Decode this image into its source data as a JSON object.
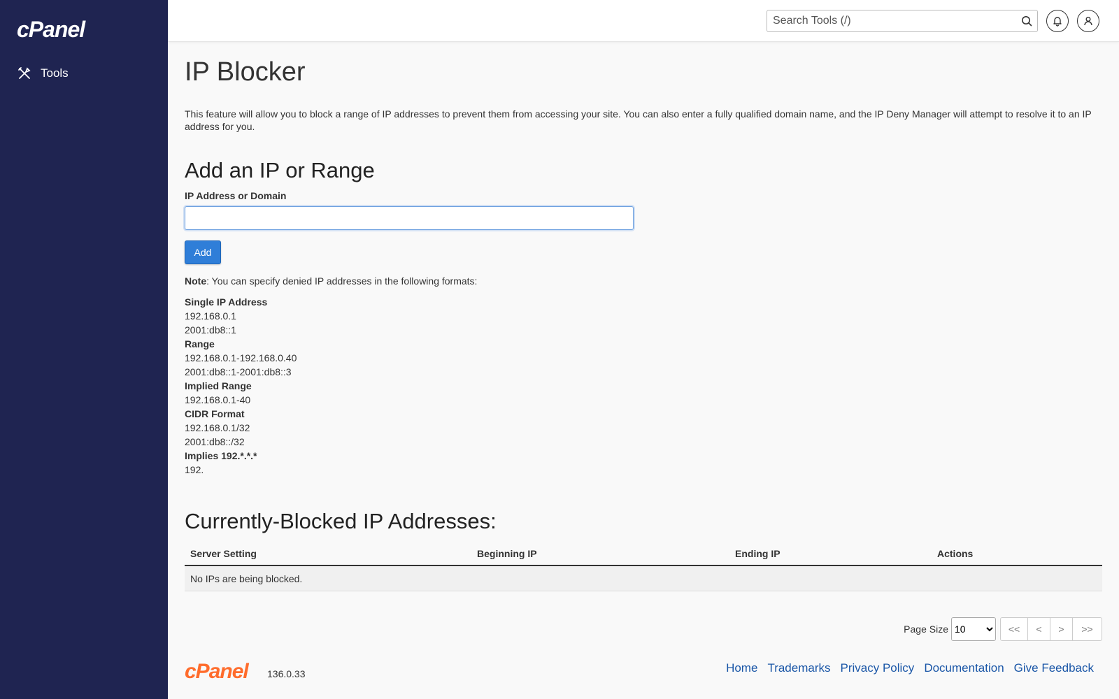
{
  "sidebar": {
    "logo": "cPanel",
    "nav": [
      {
        "label": "Tools",
        "icon": "tools-icon"
      }
    ]
  },
  "topbar": {
    "search_placeholder": "Search Tools (/)"
  },
  "page": {
    "title": "IP Blocker",
    "description": "This feature will allow you to block a range of IP addresses to prevent them from accessing your site. You can also enter a fully qualified domain name, and the IP Deny Manager will attempt to resolve it to an IP address for you."
  },
  "add_section": {
    "heading": "Add an IP or Range",
    "field_label": "IP Address or Domain",
    "field_value": "",
    "add_label": "Add",
    "note_bold": "Note",
    "note_text": ": You can specify denied IP addresses in the following formats:"
  },
  "formats": {
    "single_heading": "Single IP Address",
    "single_1": "192.168.0.1",
    "single_2": "2001:db8::1",
    "range_heading": "Range",
    "range_1": "192.168.0.1-192.168.0.40",
    "range_2": "2001:db8::1-2001:db8::3",
    "implied_heading": "Implied Range",
    "implied_1": "192.168.0.1-40",
    "cidr_heading": "CIDR Format",
    "cidr_1": "192.168.0.1/32",
    "cidr_2": "2001:db8::/32",
    "implies_heading": "Implies 192.*.*.*",
    "implies_1": "192."
  },
  "blocked_section": {
    "heading": "Currently-Blocked IP Addresses:",
    "columns": [
      "Server Setting",
      "Beginning IP",
      "Ending IP",
      "Actions"
    ],
    "empty_message": "No IPs are being blocked."
  },
  "pagination": {
    "page_size_label": "Page Size",
    "page_size_value": "10",
    "first": "<<",
    "prev": "<",
    "next": ">",
    "last": ">>"
  },
  "footer": {
    "logo": "cPanel",
    "version": "136.0.33",
    "links": [
      "Home",
      "Trademarks",
      "Privacy Policy",
      "Documentation",
      "Give Feedback"
    ]
  },
  "colors": {
    "sidebar_bg": "#1f2451",
    "primary_button": "#2f7ed8",
    "brand_orange": "#ff6c2c",
    "link": "#1a56a7"
  }
}
